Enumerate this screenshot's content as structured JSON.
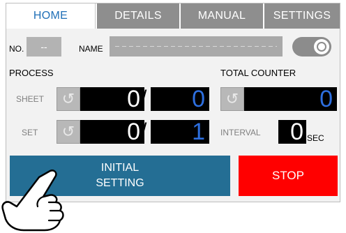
{
  "tabs": [
    {
      "label": "HOME"
    },
    {
      "label": "DETAILS"
    },
    {
      "label": "MANUAL"
    },
    {
      "label": "SETTINGS"
    }
  ],
  "header": {
    "no_label": "NO.",
    "no_value": "--",
    "name_label": "NAME",
    "toggle_icon": "power-icon"
  },
  "process": {
    "title": "PROCESS",
    "sheet_label": "SHEET",
    "sheet_current": "0",
    "sheet_target": "0",
    "set_label": "SET",
    "set_current": "0",
    "set_target": "1",
    "slash": "/"
  },
  "total_counter": {
    "title": "TOTAL COUNTER",
    "value": "0",
    "interval_label": "INTERVAL",
    "interval_value": "0",
    "interval_unit": "SEC"
  },
  "buttons": {
    "initial_line1": "INITIAL",
    "initial_line2": "SETTING",
    "stop": "STOP"
  },
  "icons": {
    "reset": "reset-icon",
    "hand": "pointing-hand-icon"
  },
  "colors": {
    "tab_active_text": "#1f6fb7",
    "tab_inactive_bg": "#8e8e8e",
    "display_bg": "#000000",
    "display_blue": "#2d6fe0",
    "initial_bg": "#246e94",
    "stop_bg": "#ff0000"
  }
}
